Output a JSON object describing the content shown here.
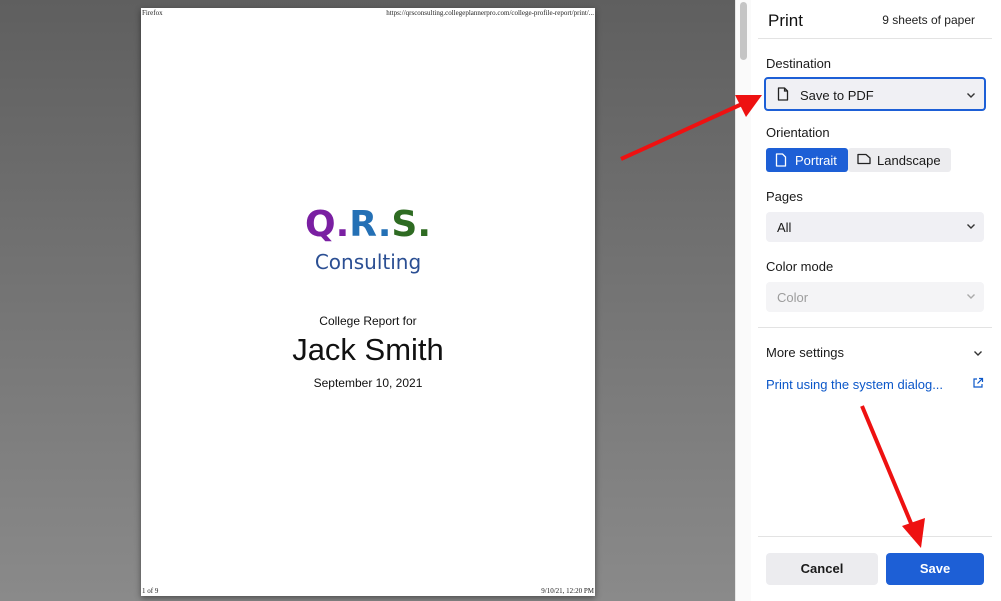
{
  "preview": {
    "header_left": "Firefox",
    "header_right": "https://qrsconsulting.collegeplannerpro.com/college-profile-report/print/...",
    "footer_left": "1 of 9",
    "footer_right": "9/10/21, 12:20 PM",
    "logo": {
      "letters": [
        {
          "char": "Q",
          "color": "#7a1fa2"
        },
        {
          "char": ".",
          "color": "#7a1fa2"
        },
        {
          "char": "R",
          "color": "#2470b5"
        },
        {
          "char": ".",
          "color": "#2470b5"
        },
        {
          "char": "S",
          "color": "#2e6b22"
        },
        {
          "char": ".",
          "color": "#2e6b22"
        }
      ],
      "subtitle": "Consulting"
    },
    "report_for": "College Report for",
    "student_name": "Jack Smith",
    "date": "September 10, 2021"
  },
  "sidebar": {
    "title": "Print",
    "sheets": "9 sheets of paper",
    "destination_label": "Destination",
    "destination_value": "Save to PDF",
    "orientation_label": "Orientation",
    "orientation_portrait": "Portrait",
    "orientation_landscape": "Landscape",
    "pages_label": "Pages",
    "pages_value": "All",
    "color_mode_label": "Color mode",
    "color_mode_value": "Color",
    "more_settings": "More settings",
    "system_dialog": "Print using the system dialog...",
    "cancel": "Cancel",
    "save": "Save"
  },
  "colors": {
    "accent": "#1d5fd6",
    "link": "#0b57c9",
    "annotation_arrow": "#ee1111"
  }
}
